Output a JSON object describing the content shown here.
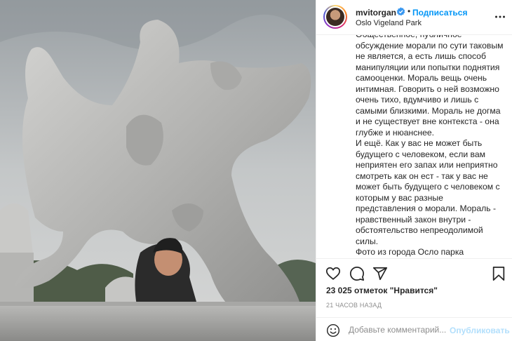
{
  "post": {
    "photo_alt": "Скульптура в парке Вигеланда",
    "username": "mvitorgan",
    "dot": "•",
    "follow_label": "Подписаться",
    "location": "Oslo Vigeland Park",
    "caption": "Общественное, публичное обсуждение морали по сути таковым не является, а есть лишь способ манипуляции или попытки поднятия самооценки. Мораль вещь очень интимная. Говорить о ней возможно очень тихо, вдумчиво и лишь с самыми близкими. Мораль не догма и не существует вне контекста - она глубже и нюанснее.\nИ ещё. Как у вас не может быть будущего с человеком, если вам неприятен его запах или неприятно смотреть как он ест - так у вас не может быть будущего с человеком с которым у вас разные представления о морали. Мораль - нравственный закон внутри - обстоятельство непреодолимой силы.\nФото из города Осло парка скульптур Вигеланд - места чисто",
    "likes": "23 025 отметок \"Нравится\"",
    "time": "21 ЧАСОВ НАЗАД",
    "comment_placeholder": "Добавьте комментарий...",
    "publish_label": "Опубликовать"
  },
  "icons": {
    "verified": "verified-badge-icon",
    "more": "more-horizontal-icon",
    "like": "heart-icon",
    "comment": "comment-icon",
    "share": "share-icon",
    "save": "bookmark-icon",
    "emoji": "emoji-icon"
  },
  "colors": {
    "link_blue": "#0095f6",
    "publish_disabled": "#b2dffc",
    "secondary_text": "#8e8e8e",
    "border": "#efefef"
  }
}
